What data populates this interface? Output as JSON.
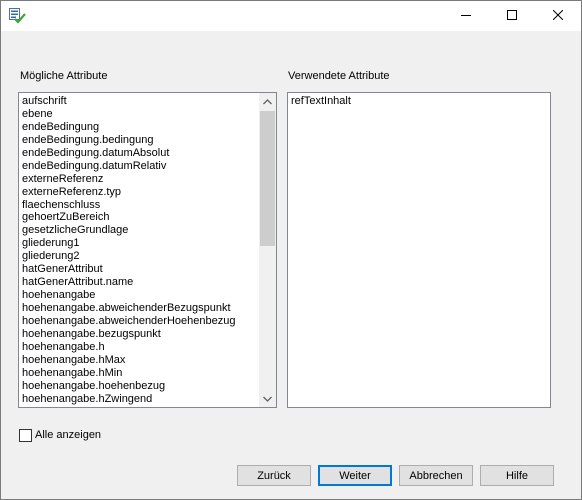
{
  "titlebar": {
    "app_icon": "list-check-icon",
    "minimize_icon": "minimize-icon",
    "maximize_icon": "maximize-icon",
    "close_icon": "close-icon"
  },
  "available": {
    "label": "Mögliche Attribute",
    "items": [
      "aufschrift",
      "ebene",
      "endeBedingung",
      "endeBedingung.bedingung",
      "endeBedingung.datumAbsolut",
      "endeBedingung.datumRelativ",
      "externeReferenz",
      "externeReferenz.typ",
      "flaechenschluss",
      "gehoertZuBereich",
      "gesetzlicheGrundlage",
      "gliederung1",
      "gliederung2",
      "hatGenerAttribut",
      "hatGenerAttribut.name",
      "hoehenangabe",
      "hoehenangabe.abweichenderBezugspunkt",
      "hoehenangabe.abweichenderHoehenbezug",
      "hoehenangabe.bezugspunkt",
      "hoehenangabe.h",
      "hoehenangabe.hMax",
      "hoehenangabe.hMin",
      "hoehenangabe.hoehenbezug",
      "hoehenangabe.hZwingend"
    ]
  },
  "used": {
    "label": "Verwendete Attribute",
    "items": [
      "refTextInhalt"
    ]
  },
  "show_all": {
    "label": "Alle anzeigen",
    "checked": false
  },
  "buttons": {
    "back": "Zurück",
    "next": "Weiter",
    "cancel": "Abbrechen",
    "help": "Hilfe"
  },
  "colors": {
    "dialog_bg": "#f0f0f0",
    "focus_border": "#0078d7",
    "check_green": "#3aa53a"
  }
}
